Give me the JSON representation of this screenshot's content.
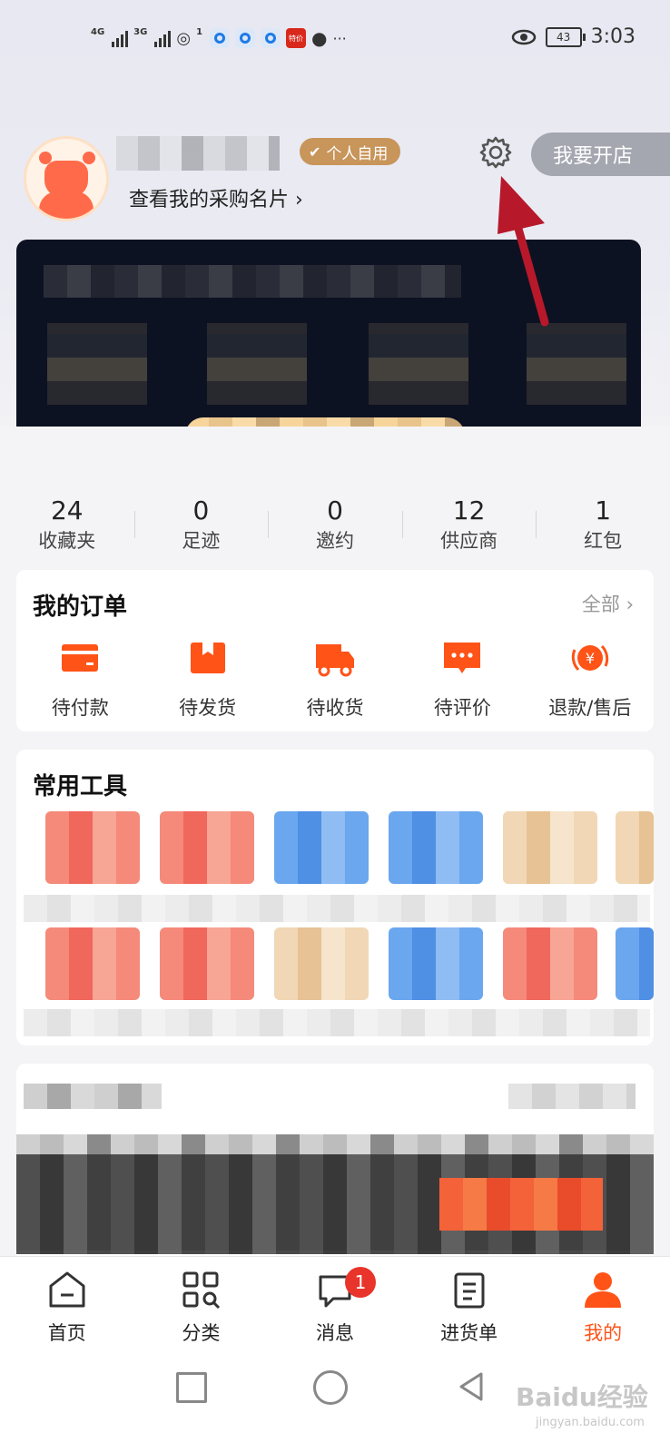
{
  "status_bar": {
    "net1": "4G",
    "net2": "3G",
    "hotspot_count": "1",
    "app_badge": "特价",
    "dots": "···",
    "battery": "43",
    "time": "3:03"
  },
  "profile": {
    "badge": "个人自用",
    "card_link": "查看我的采购名片 ›",
    "open_shop_button": "我要开店"
  },
  "stats": [
    {
      "value": "24",
      "label": "收藏夹"
    },
    {
      "value": "0",
      "label": "足迹"
    },
    {
      "value": "0",
      "label": "邀约"
    },
    {
      "value": "12",
      "label": "供应商"
    },
    {
      "value": "1",
      "label": "红包"
    }
  ],
  "orders": {
    "title": "我的订单",
    "all_link": "全部 ›",
    "items": [
      {
        "label": "待付款",
        "icon": "card-icon"
      },
      {
        "label": "待发货",
        "icon": "package-icon"
      },
      {
        "label": "待收货",
        "icon": "truck-icon"
      },
      {
        "label": "待评价",
        "icon": "comment-icon"
      },
      {
        "label": "退款/售后",
        "icon": "refund-icon"
      }
    ]
  },
  "tools": {
    "title": "常用工具"
  },
  "tabbar": [
    {
      "label": "首页",
      "icon": "home-icon"
    },
    {
      "label": "分类",
      "icon": "category-icon"
    },
    {
      "label": "消息",
      "icon": "message-icon",
      "badge": "1"
    },
    {
      "label": "进货单",
      "icon": "clipboard-icon"
    },
    {
      "label": "我的",
      "icon": "profile-icon",
      "active": true
    }
  ],
  "watermark": {
    "text": "Baidu经验",
    "sub": "jingyan.baidu.com"
  },
  "colors": {
    "accent": "#ff5317",
    "badge_gold": "#c8955a",
    "arrow_red": "#b7192a"
  }
}
